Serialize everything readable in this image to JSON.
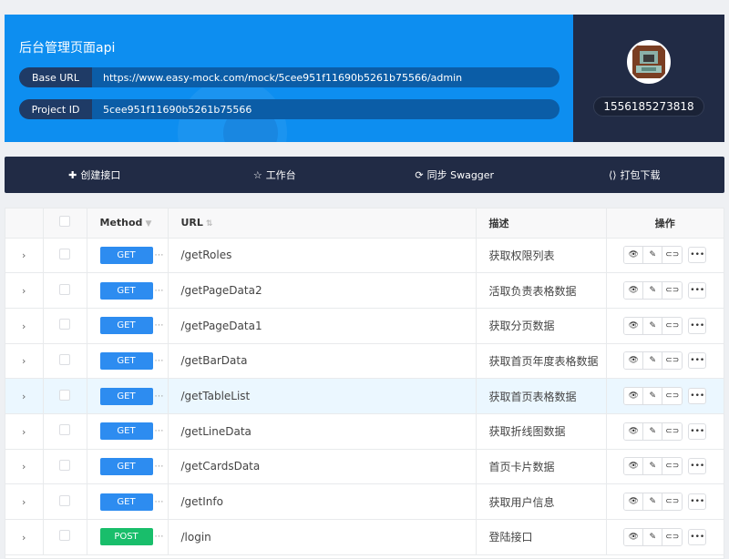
{
  "project": {
    "title": "后台管理页面api",
    "base_url_label": "Base URL",
    "base_url": "https://www.easy-mock.com/mock/5cee951f11690b5261b75566/admin",
    "project_id_label": "Project ID",
    "project_id": "5cee951f11690b5261b75566"
  },
  "user": {
    "id": "1556185273818"
  },
  "toolbar": {
    "create": "创建接口",
    "workbench": "工作台",
    "sync": "同步 Swagger",
    "download": "打包下载"
  },
  "table": {
    "headers": {
      "method": "Method",
      "url": "URL",
      "desc": "描述",
      "ops": "操作"
    },
    "rows": [
      {
        "method": "GET",
        "url": "/getRoles",
        "desc": "获取权限列表"
      },
      {
        "method": "GET",
        "url": "/getPageData2",
        "desc": "活取负责表格数据"
      },
      {
        "method": "GET",
        "url": "/getPageData1",
        "desc": "获取分页数据"
      },
      {
        "method": "GET",
        "url": "/getBarData",
        "desc": "获取首页年度表格数据"
      },
      {
        "method": "GET",
        "url": "/getTableList",
        "desc": "获取首页表格数据"
      },
      {
        "method": "GET",
        "url": "/getLineData",
        "desc": "获取折线图数据"
      },
      {
        "method": "GET",
        "url": "/getCardsData",
        "desc": "首页卡片数据"
      },
      {
        "method": "GET",
        "url": "/getInfo",
        "desc": "获取用户信息"
      },
      {
        "method": "POST",
        "url": "/login",
        "desc": "登陆接口"
      }
    ]
  },
  "colors": {
    "hero": "#0d8ef0",
    "dark": "#212b45",
    "get": "#2d8cf0",
    "post": "#19be6b",
    "highlight_row": "#ebf7ff"
  }
}
